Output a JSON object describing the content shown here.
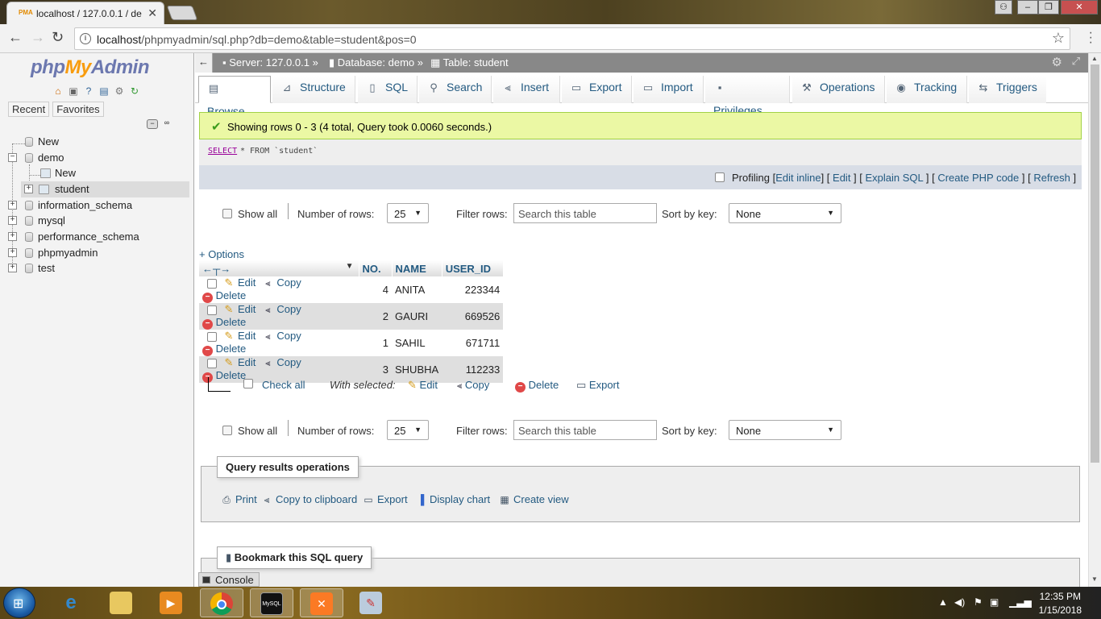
{
  "browser": {
    "tab_title": "localhost / 127.0.0.1 / de",
    "tab_favicon": "PMA",
    "url_host": "localhost",
    "url_path": "/phpmyadmin/sql.php?db=demo&table=student&pos=0"
  },
  "nav": {
    "logo_php": "php",
    "logo_my": "My",
    "logo_admin": "Admin",
    "recent_label": "Recent",
    "favorites_label": "Favorites",
    "tree": [
      {
        "label": "New",
        "level": 1
      },
      {
        "label": "demo",
        "level": 0
      },
      {
        "label": "New",
        "level": 2
      },
      {
        "label": "student",
        "level": 2
      },
      {
        "label": "information_schema",
        "level": 0
      },
      {
        "label": "mysql",
        "level": 0
      },
      {
        "label": "performance_schema",
        "level": 0
      },
      {
        "label": "phpmyadmin",
        "level": 0
      },
      {
        "label": "test",
        "level": 0
      }
    ]
  },
  "breadcrumb": {
    "server": "Server: 127.0.0.1",
    "database": "Database: demo",
    "table": "Table: student"
  },
  "menu": {
    "tabs": [
      {
        "label": "Browse",
        "icon": "browse-icon"
      },
      {
        "label": "Structure",
        "icon": "structure-icon"
      },
      {
        "label": "SQL",
        "icon": "sql-icon"
      },
      {
        "label": "Search",
        "icon": "search-icon"
      },
      {
        "label": "Insert",
        "icon": "insert-icon"
      },
      {
        "label": "Export",
        "icon": "export-icon"
      },
      {
        "label": "Import",
        "icon": "import-icon"
      },
      {
        "label": "Privileges",
        "icon": "privileges-icon"
      },
      {
        "label": "Operations",
        "icon": "operations-icon"
      },
      {
        "label": "Tracking",
        "icon": "tracking-icon"
      },
      {
        "label": "Triggers",
        "icon": "triggers-icon"
      }
    ]
  },
  "result": {
    "success_message": "Showing rows 0 - 3 (4 total, Query took 0.0060 seconds.)",
    "sql_keyword": "SELECT",
    "sql_rest": "* FROM `student`",
    "profiling_label": "Profiling",
    "profiling_links": [
      "Edit inline",
      "Edit",
      "Explain SQL",
      "Create PHP code",
      "Refresh"
    ]
  },
  "controls": {
    "show_all": "Show all",
    "number_of_rows_label": "Number of rows:",
    "number_of_rows_value": "25",
    "filter_rows_label": "Filter rows:",
    "filter_placeholder": "Search this table",
    "sort_by_key_label": "Sort by key:",
    "sort_by_key_value": "None",
    "options_link": "+ Options"
  },
  "table": {
    "columns": [
      "NO.",
      "NAME",
      "USER_ID"
    ],
    "action_labels": {
      "edit": "Edit",
      "copy": "Copy",
      "delete": "Delete"
    },
    "rows": [
      {
        "no": "4",
        "name": "ANITA",
        "user_id": "223344"
      },
      {
        "no": "2",
        "name": "GAURI",
        "user_id": "669526"
      },
      {
        "no": "1",
        "name": "SAHIL",
        "user_id": "671711"
      },
      {
        "no": "3",
        "name": "SHUBHA",
        "user_id": "112233"
      }
    ]
  },
  "with_selected": {
    "check_all": "Check all",
    "label": "With selected:",
    "edit": "Edit",
    "copy": "Copy",
    "delete": "Delete",
    "export": "Export"
  },
  "query_ops": {
    "legend": "Query results operations",
    "print": "Print",
    "copy_clipboard": "Copy to clipboard",
    "export": "Export",
    "display_chart": "Display chart",
    "create_view": "Create view"
  },
  "bookmark": {
    "legend": "Bookmark this SQL query"
  },
  "console": {
    "label": "Console"
  },
  "taskbar": {
    "time": "12:35 PM",
    "date": "1/15/2018",
    "mysql_label": "MySQL"
  }
}
